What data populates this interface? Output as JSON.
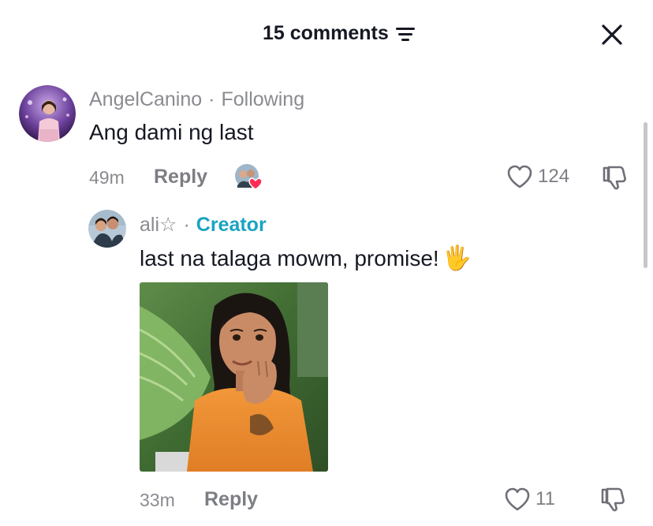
{
  "header": {
    "title": "15 comments",
    "sort_icon": "sort-lines-icon",
    "close_icon": "close-icon"
  },
  "comments": [
    {
      "username": "AngelCanino",
      "tag": "Following",
      "text": "Ang dami ng last",
      "time": "49m",
      "reply_label": "Reply",
      "likes": "124",
      "liked_by_creator": true
    }
  ],
  "replies": [
    {
      "username": "ali☆",
      "tag": "Creator",
      "text": "last na talaga mowm, promise!",
      "emoji": "🖐",
      "time": "33m",
      "reply_label": "Reply",
      "likes": "11",
      "has_gif": true
    }
  ],
  "colors": {
    "creator_tag": "#1aa3c2",
    "muted_text": "#8a8b91",
    "heart_badge": "#fe2c55"
  }
}
